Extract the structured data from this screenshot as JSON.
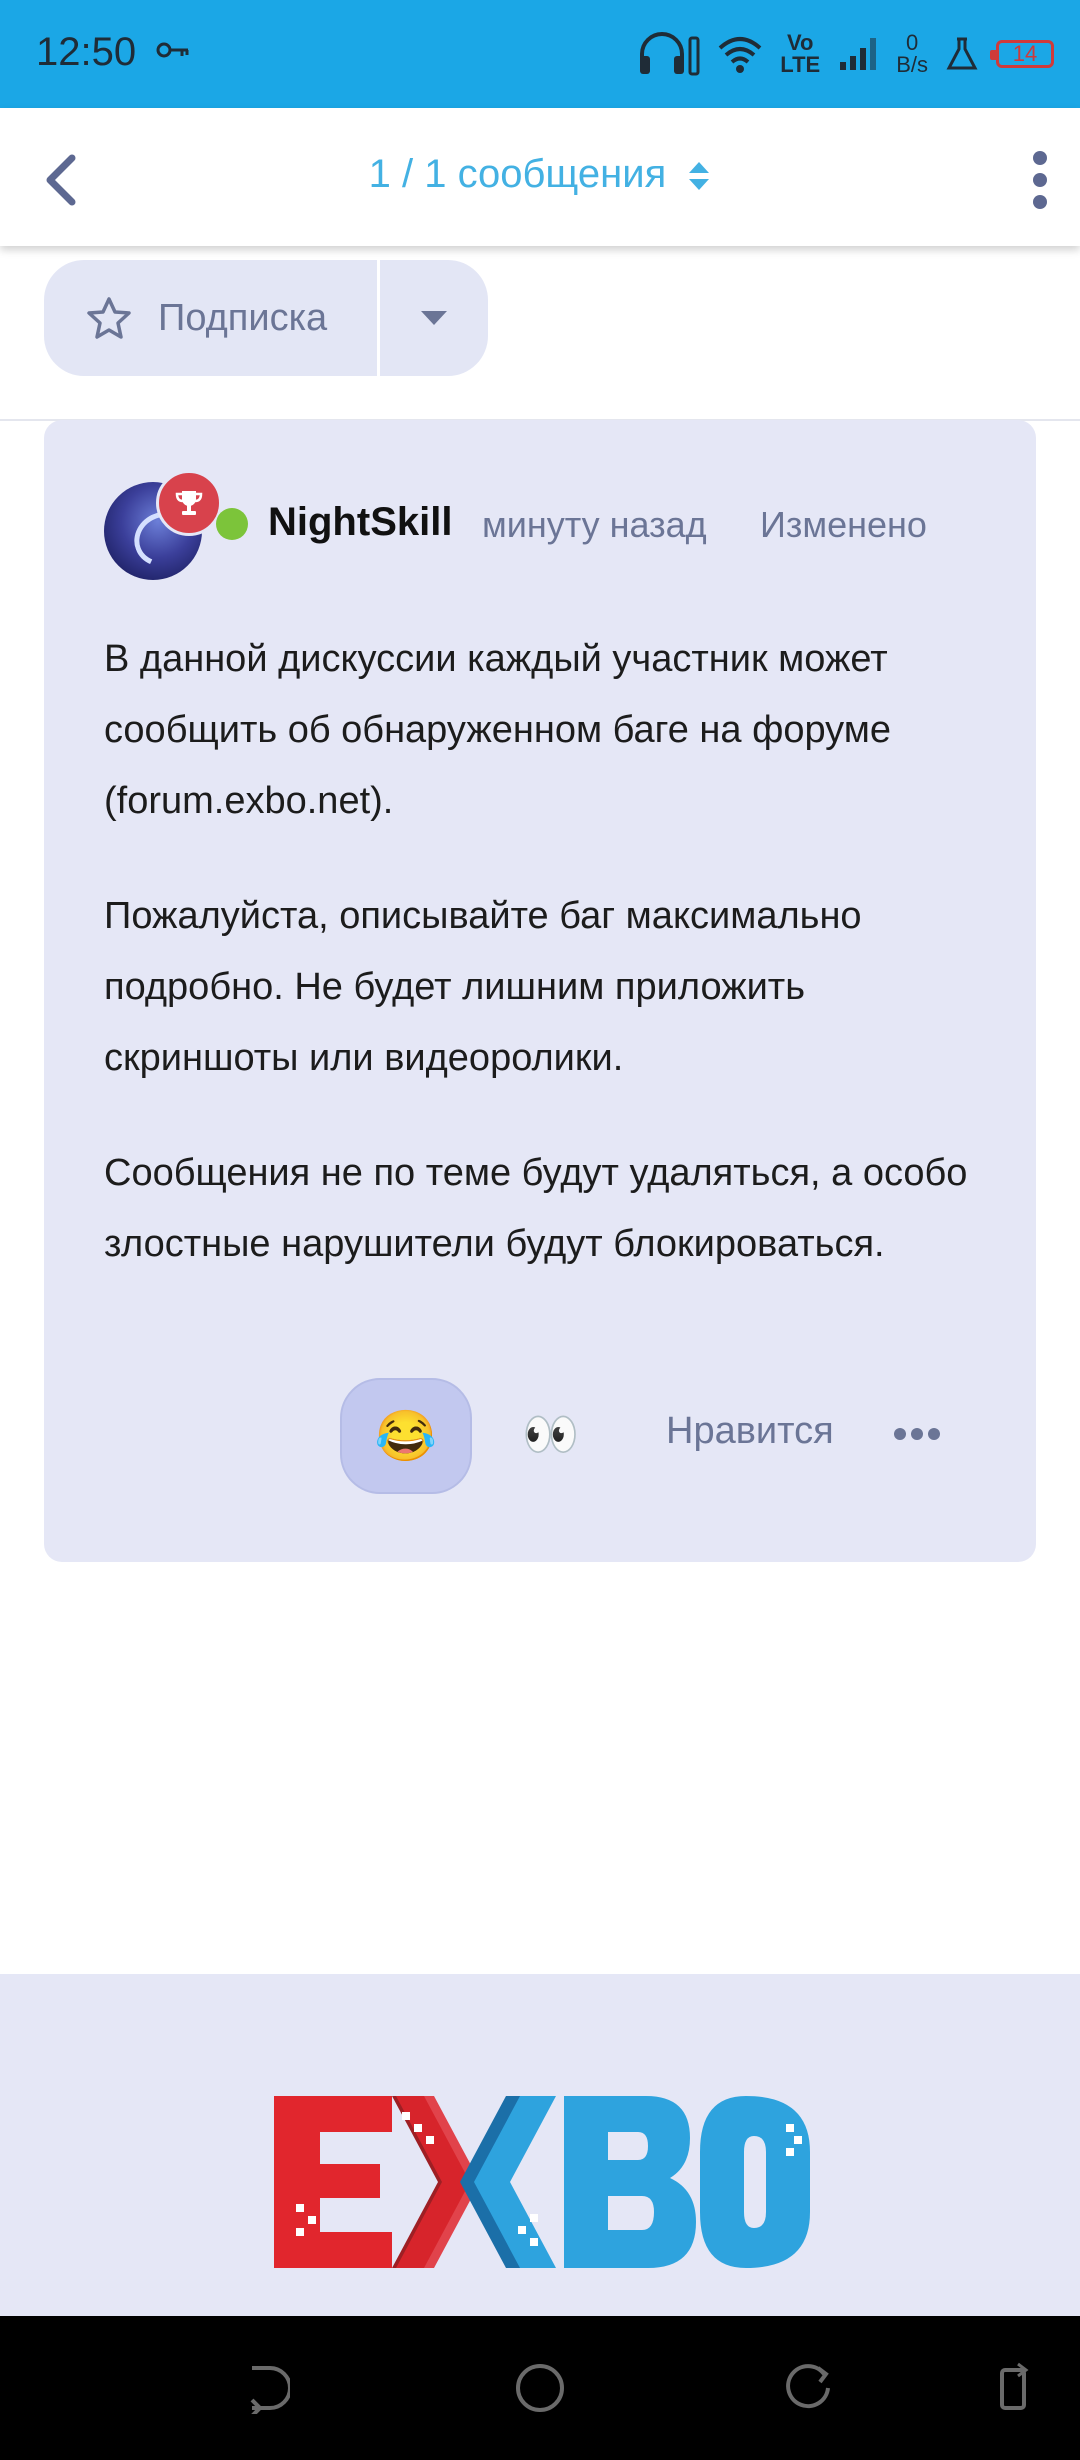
{
  "status_bar": {
    "time": "12:50",
    "net_speed_value": "0",
    "net_speed_unit": "B/s",
    "vo_lte_1": "Vo",
    "vo_lte_2": "LTE",
    "battery": "14"
  },
  "app_bar": {
    "title": "1 / 1 сообщения"
  },
  "subscribe": {
    "label": "Подписка"
  },
  "post": {
    "username": "NightSkill",
    "time_ago": "минуту назад",
    "edited_label": "Изменено",
    "paragraphs": [
      "В данной дискуссии каждый участник может сообщить об обнаруженном баге на форуме (forum.exbo.net).",
      "Пожалуйста, описывайте баг максимально подробно. Не будет лишним приложить скриншоты или видеоролики.",
      "Сообщения не по теме будут удаляться, а особо злостные нарушители будут блокироваться."
    ],
    "reactions": [
      "😂",
      "👀"
    ],
    "like_label": "Нравится"
  },
  "footer": {
    "logo_text": "EXBO"
  },
  "colors": {
    "status_bar": "#1ba7e6",
    "accent": "#43b1e3",
    "post_bg": "#e5e7f6",
    "muted": "#6b7596",
    "online": "#7cc43a",
    "badge": "#d8424c"
  }
}
